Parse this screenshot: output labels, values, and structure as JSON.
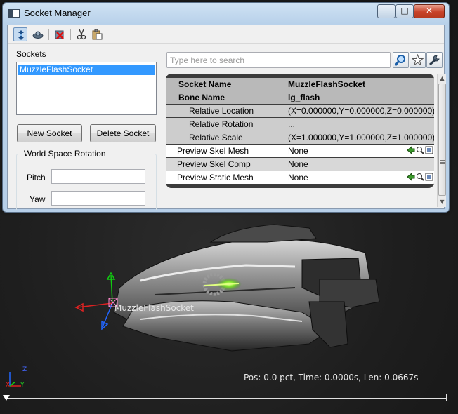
{
  "window": {
    "title": "Socket Manager",
    "controls": {
      "minimize": "–",
      "maximize": "□",
      "close": "✕"
    }
  },
  "toolbar": {
    "buttons": [
      {
        "icon": "socket-edit-icon",
        "active": true
      },
      {
        "icon": "rotate-icon",
        "active": false
      },
      {
        "icon": "delete-icon",
        "active": false
      },
      {
        "icon": "cut-icon",
        "active": false
      },
      {
        "icon": "paste-icon",
        "active": false
      }
    ]
  },
  "sockets": {
    "label": "Sockets",
    "items": [
      "MuzzleFlashSocket"
    ],
    "selected": "MuzzleFlashSocket",
    "new_button": "New Socket",
    "delete_button": "Delete Socket"
  },
  "rotation": {
    "group_label": "World Space Rotation",
    "pitch_label": "Pitch",
    "yaw_label": "Yaw",
    "pitch_value": "",
    "yaw_value": ""
  },
  "search": {
    "placeholder": "Type here to search"
  },
  "properties": {
    "rows": [
      {
        "name": "Socket Name",
        "value": "MuzzleFlashSocket"
      },
      {
        "name": "Bone Name",
        "value": "lg_flash"
      },
      {
        "name": "Relative Location",
        "value": "(X=0.000000,Y=0.000000,Z=0.000000)"
      },
      {
        "name": "Relative Rotation",
        "value": "..."
      },
      {
        "name": "Relative Scale",
        "value": "(X=1.000000,Y=1.000000,Z=1.000000)"
      },
      {
        "name": "Preview Skel Mesh",
        "value": "None"
      },
      {
        "name": "Preview Skel Comp",
        "value": "None"
      },
      {
        "name": "Preview Static Mesh",
        "value": "None"
      }
    ]
  },
  "viewport": {
    "socket_label": "MuzzleFlashSocket",
    "status": "Pos: 0.0 pct, Time: 0.0000s, Len: 0.0667s",
    "axis_labels": {
      "x": "X",
      "y": "Y",
      "z": "Z"
    }
  },
  "colors": {
    "selection": "#3399ff",
    "grid_dark": "#3c3c3c",
    "category_row": "#b9b9b9",
    "window_frame": "#b8d1ea"
  }
}
